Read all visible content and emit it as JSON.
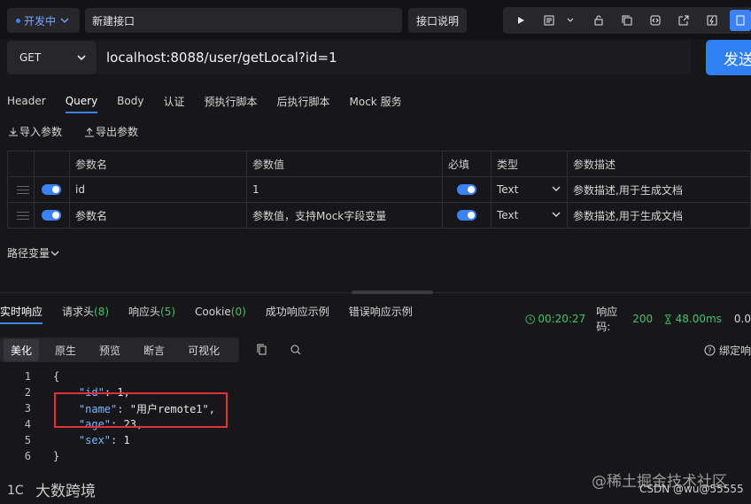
{
  "topbar": {
    "environment": "开发中",
    "tab_name": "新建接口",
    "doc_button": "接口说明",
    "tools": [
      "play-icon",
      "doc-icon",
      "chevron-down-icon",
      "lock-icon",
      "copy-icon",
      "code-icon",
      "share-icon",
      "lightning-icon",
      "save-icon"
    ]
  },
  "request": {
    "method": "GET",
    "url": "localhost:8088/user/getLocal?id=1",
    "send_label": "发送"
  },
  "request_tabs": [
    "Header",
    "Query",
    "Body",
    "认证",
    "预执行脚本",
    "后执行脚本",
    "Mock 服务"
  ],
  "active_request_tab": "Query",
  "param_actions": {
    "import": "导入参数",
    "export": "导出参数"
  },
  "param_table": {
    "headers": {
      "name": "参数名",
      "value": "参数值",
      "required": "必填",
      "type": "类型",
      "desc": "参数描述"
    },
    "rows": [
      {
        "name": "id",
        "value": "1",
        "type": "Text",
        "desc": "参数描述,用于生成文档"
      },
      {
        "name": "参数名",
        "value": "参数值，支持Mock字段变量",
        "type": "Text",
        "desc": "参数描述,用于生成文档"
      }
    ]
  },
  "path_variables": "路径变量",
  "response_tabs": {
    "realtime": "实时响应",
    "req_headers": "请求头",
    "req_headers_count": "(8)",
    "resp_headers": "响应头",
    "resp_headers_count": "(5)",
    "cookie": "Cookie",
    "cookie_count": "(0)",
    "success_example": "成功响应示例",
    "error_example": "错误响应示例"
  },
  "response_meta": {
    "time": "00:20:27",
    "status_label": "响应码:",
    "status_code": "200",
    "duration": "48.00ms",
    "size": "0.0"
  },
  "view_modes": [
    "美化",
    "原生",
    "预览",
    "断言",
    "可视化"
  ],
  "bind_label": "绑定响",
  "response_body": {
    "line_numbers": [
      "1",
      "2",
      "3",
      "4",
      "5",
      "6"
    ],
    "id_key": "\"id\"",
    "id_value": "1",
    "name_key": "\"name\"",
    "name_value": "\"用户remote1\"",
    "age_key": "\"age\"",
    "age_value": "23",
    "sex_key": "\"sex\"",
    "sex_value": "1"
  },
  "watermarks": {
    "bottom_left": "大数跨境",
    "juejin": "@稀土掘金技术社区",
    "csdn": "CSDN @wu@55555"
  }
}
